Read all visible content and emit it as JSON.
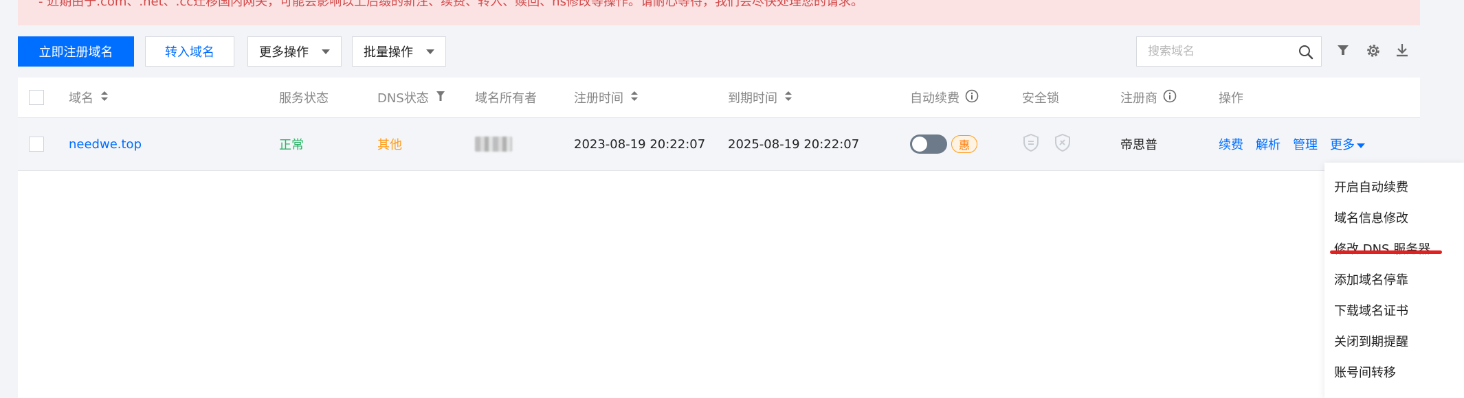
{
  "notice": {
    "text": "- 近期由于.com、.net、.cc迁移国内网关，可能会影响以上后缀的新注、续费、转入、赎回、ns修改等操作。请耐心等待，我们会尽快处理您的请求。"
  },
  "toolbar": {
    "register_label": "立即注册域名",
    "transfer_in_label": "转入域名",
    "more_actions_label": "更多操作",
    "batch_actions_label": "批量操作"
  },
  "search": {
    "placeholder": "搜索域名",
    "value": ""
  },
  "icons": {
    "search": "search-icon",
    "filter": "filter-icon",
    "settings": "gear-icon",
    "download": "download-icon",
    "sort": "sort-icon",
    "info": "info-icon",
    "caret": "caret-down-icon",
    "lock1": "shield-lock-icon",
    "lock2": "shield-lock-icon"
  },
  "colors": {
    "primary": "#006eff",
    "success": "#29b466",
    "warning": "#ff9c19",
    "notice_bg": "#fbe2e3",
    "notice_text": "#d24a4a",
    "highlight": "#e32020"
  },
  "table": {
    "columns": {
      "domain": "域名",
      "service_status": "服务状态",
      "dns_status": "DNS状态",
      "owner": "域名所有者",
      "reg_time": "注册时间",
      "expire_time": "到期时间",
      "auto_renew": "自动续费",
      "security_lock": "安全锁",
      "registrar": "注册商",
      "actions": "操作"
    },
    "rows": [
      {
        "domain": "needwe.top",
        "service_status": "正常",
        "dns_status": "其他",
        "reg_time": "2023-08-19 20:22:07",
        "expire_time": "2025-08-19 20:22:07",
        "auto_renew_badge": "惠",
        "auto_renew_on": false,
        "registrar": "帝思普",
        "actions": {
          "renew": "续费",
          "resolve": "解析",
          "manage": "管理",
          "more": "更多"
        }
      }
    ]
  },
  "dropdown": {
    "items": [
      "开启自动续费",
      "域名信息修改",
      "修改 DNS 服务器",
      "添加域名停靠",
      "下载域名证书",
      "关闭到期提醒",
      "账号间转移"
    ]
  }
}
